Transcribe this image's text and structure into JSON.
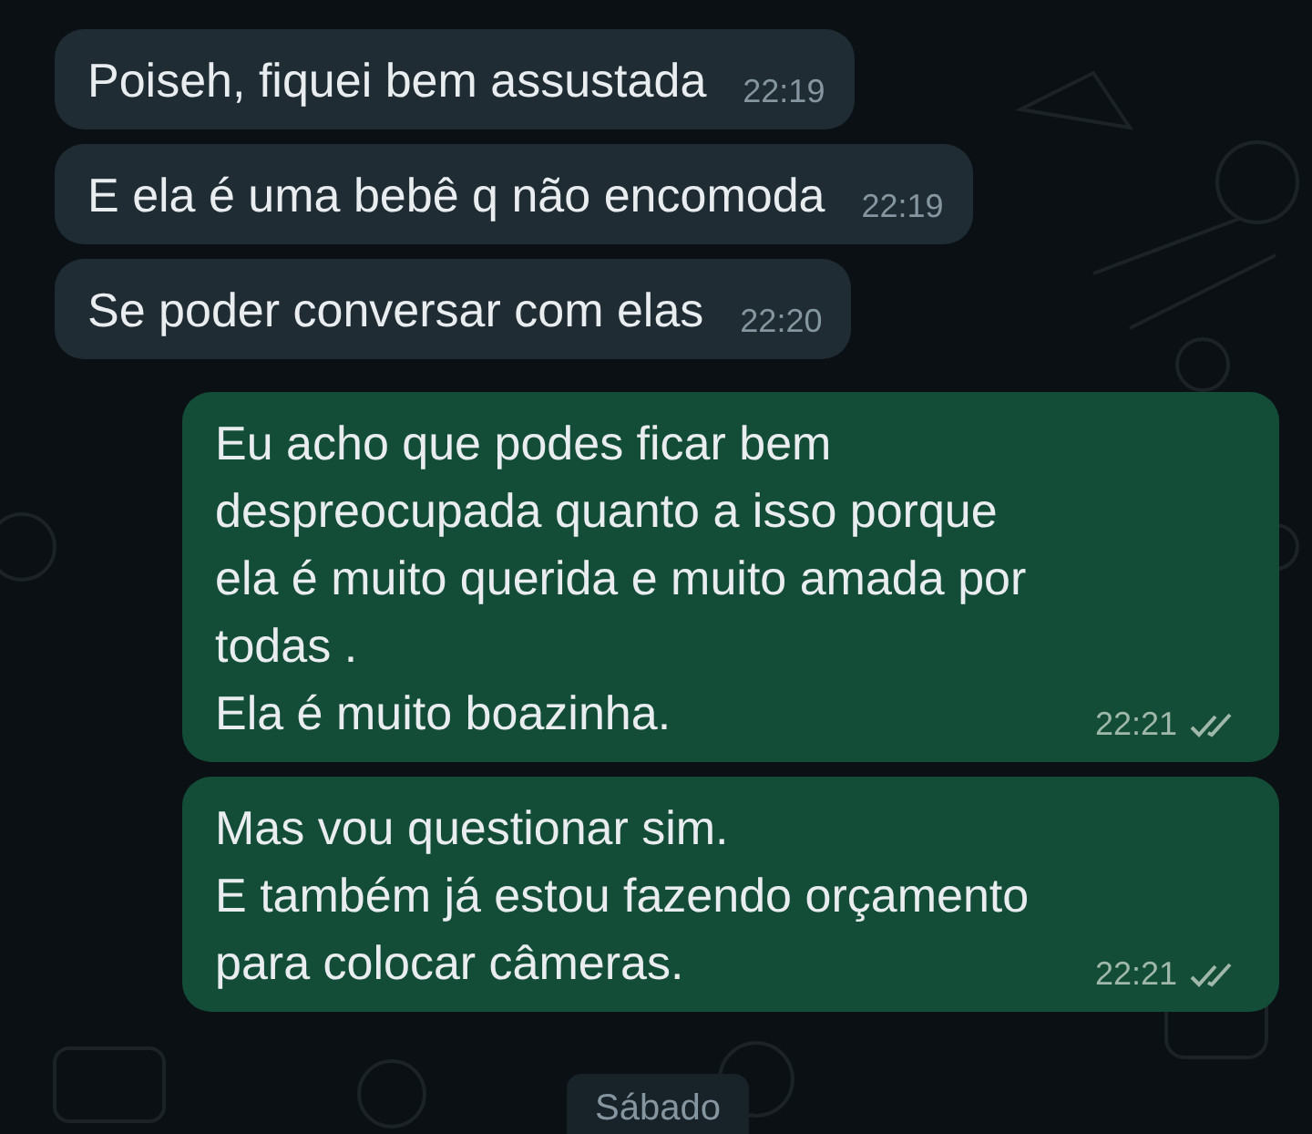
{
  "messages": [
    {
      "kind": "incoming",
      "text": "Poiseh, fiquei bem assustada",
      "time": "22:19"
    },
    {
      "kind": "incoming",
      "text": "E ela é uma bebê q não encomoda",
      "time": "22:19"
    },
    {
      "kind": "incoming",
      "text": "Se poder conversar com elas",
      "time": "22:20"
    },
    {
      "kind": "outgoing",
      "text": "Eu acho que podes ficar bem\ndespreocupada quanto a isso porque\nela é muito querida e muito amada por\ntodas .\nEla é muito boazinha.",
      "time": "22:21",
      "read": false
    },
    {
      "kind": "outgoing",
      "text": "Mas vou questionar sim.\nE também já estou fazendo orçamento\npara colocar câmeras.",
      "time": "22:21",
      "read": false
    }
  ],
  "date_chip": "Sábado"
}
